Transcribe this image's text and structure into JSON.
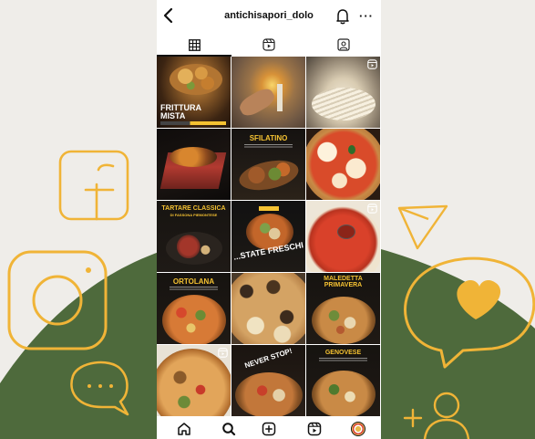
{
  "profile": {
    "username": "antichisapori_dolo"
  },
  "tabs": [
    {
      "name": "posts-grid-icon",
      "active": true
    },
    {
      "name": "reels-icon",
      "active": false
    },
    {
      "name": "tagged-icon",
      "active": false
    }
  ],
  "posts": {
    "p1": {
      "title_line1": "FRITTURA",
      "title_line2": "MISTA",
      "reel": false
    },
    "p2": {
      "reel": false
    },
    "p3": {
      "reel": true
    },
    "p4": {
      "reel": false
    },
    "p5": {
      "title": "SFILATINO",
      "reel": false
    },
    "p6": {
      "reel": false
    },
    "p7": {
      "title": "TARTARE CLASSICA",
      "subtitle": "DI FASSONA PIEMONTESE",
      "reel": false
    },
    "p8": {
      "overlay": "...STATE FRESCHI",
      "reel": false
    },
    "p9": {
      "reel": true
    },
    "p10": {
      "title": "ORTOLANA",
      "reel": false
    },
    "p11": {
      "reel": false
    },
    "p12": {
      "title_line1": "MALEDETTA",
      "title_line2": "PRIMAVERA",
      "reel": false
    },
    "p13": {
      "reel": true
    },
    "p14": {
      "overlay": "NEVER STOP!",
      "reel": false
    },
    "p15": {
      "title": "GENOVESE",
      "reel": false
    }
  },
  "bottom_nav": [
    "home-icon",
    "search-icon",
    "create-icon",
    "reels-nav-icon",
    "profile-avatar"
  ],
  "colors": {
    "accent": "#f0b437",
    "background": "#efede9",
    "hill": "#4e6a3c",
    "caption_yellow": "#f5c232"
  }
}
